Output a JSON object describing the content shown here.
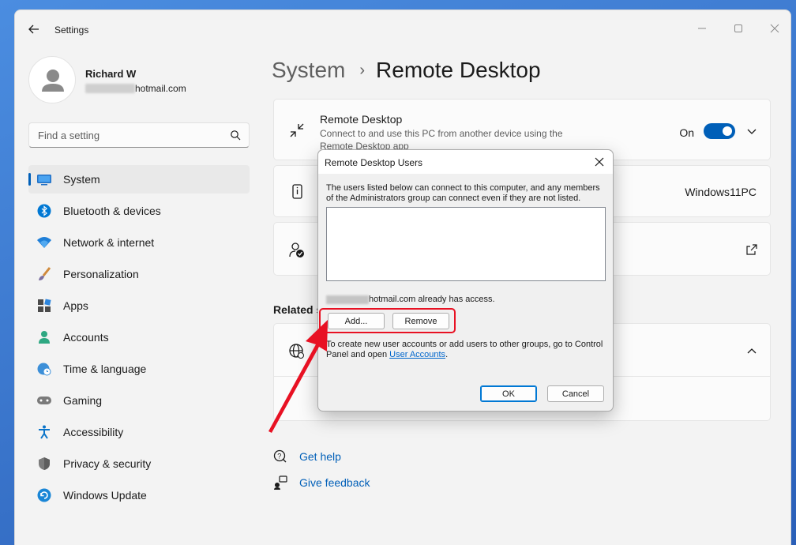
{
  "app": {
    "title": "Settings"
  },
  "profile": {
    "name": "Richard W",
    "email_visible": "hotmail.com"
  },
  "search": {
    "placeholder": "Find a setting"
  },
  "nav": [
    {
      "label": "System",
      "icon": "monitor-icon",
      "selected": true
    },
    {
      "label": "Bluetooth & devices",
      "icon": "bluetooth-icon"
    },
    {
      "label": "Network & internet",
      "icon": "wifi-icon"
    },
    {
      "label": "Personalization",
      "icon": "brush-icon"
    },
    {
      "label": "Apps",
      "icon": "apps-icon"
    },
    {
      "label": "Accounts",
      "icon": "person-icon"
    },
    {
      "label": "Time & language",
      "icon": "globe-clock-icon"
    },
    {
      "label": "Gaming",
      "icon": "gamepad-icon"
    },
    {
      "label": "Accessibility",
      "icon": "accessibility-icon"
    },
    {
      "label": "Privacy & security",
      "icon": "shield-icon"
    },
    {
      "label": "Windows Update",
      "icon": "update-icon"
    }
  ],
  "breadcrumb": {
    "parent": "System",
    "current": "Remote Desktop"
  },
  "remote_card": {
    "title": "Remote Desktop",
    "description": "Connect to and use this PC from another device using the Remote Desktop app",
    "toggle_label": "On",
    "toggle_on": true
  },
  "pc_card": {
    "pc_name": "Windows11PC"
  },
  "related": {
    "label": "Related s"
  },
  "links": {
    "help": "Get help",
    "feedback": "Give feedback"
  },
  "dialog": {
    "title": "Remote Desktop Users",
    "description": "The users listed below can connect to this computer, and any members of the Administrators group can connect even if they are not listed.",
    "access_text": "hotmail.com already has access.",
    "add_label": "Add...",
    "remove_label": "Remove",
    "info_text": "To create new user accounts or add users to other groups, go to Control Panel and open",
    "info_link": "User Accounts",
    "info_end": ".",
    "ok_label": "OK",
    "cancel_label": "Cancel"
  },
  "colors": {
    "accent": "#005fb8",
    "highlight": "#e81123"
  }
}
